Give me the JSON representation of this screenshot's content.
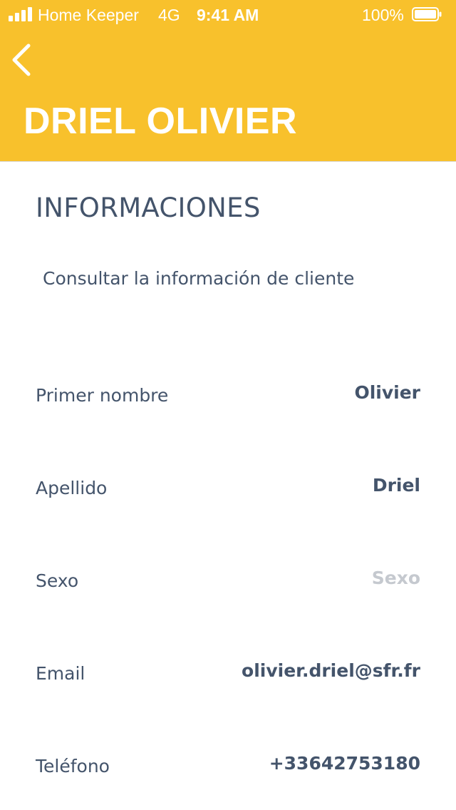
{
  "status_bar": {
    "carrier": "Home Keeper",
    "network": "4G",
    "time": "9:41 AM",
    "battery": "100%",
    "signal_bars": 4,
    "battery_level": 1.0
  },
  "header": {
    "back_icon": "chevron-left-icon",
    "title": "DRIEL OLIVIER",
    "background_color": "#f8c12c"
  },
  "section": {
    "title": "INFORMACIONES",
    "description": "Consultar la información de cliente"
  },
  "fields": [
    {
      "label": "Primer nombre",
      "value": "Olivier",
      "is_placeholder": false
    },
    {
      "label": "Apellido",
      "value": "Driel",
      "is_placeholder": false
    },
    {
      "label": "Sexo",
      "value": "Sexo",
      "is_placeholder": true
    },
    {
      "label": "Email",
      "value": "olivier.driel@sfr.fr",
      "is_placeholder": false
    },
    {
      "label": "Teléfono",
      "value": "+33642753180",
      "is_placeholder": false
    }
  ],
  "colors": {
    "accent": "#f8c12c",
    "text": "#44546b",
    "placeholder": "#c5c9cf"
  }
}
